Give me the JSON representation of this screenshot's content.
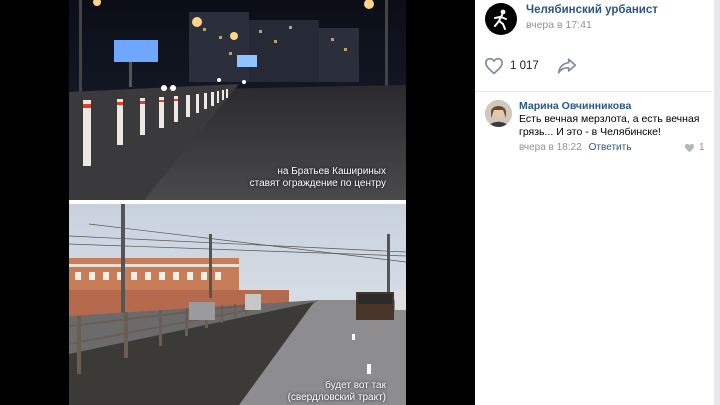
{
  "post": {
    "group_name": "Челябинский урбанист",
    "time": "вчера в 17:41",
    "likes": "1 017",
    "photo1_caption": [
      "на Братьев Кашириных",
      "ставят ограждение по центру"
    ],
    "photo2_caption": [
      "будет вот так",
      "(свердловский тракт)"
    ]
  },
  "comment": {
    "author": "Марина Овчинникова",
    "text": "Есть вечная мерзлота, а есть вечная грязь... И это - в Челябинске!",
    "time": "вчера в 18:22",
    "reply_label": "Ответить",
    "likes": "1"
  },
  "colors": {
    "link": "#2a5885",
    "muted": "#939393",
    "background": "#000000"
  }
}
